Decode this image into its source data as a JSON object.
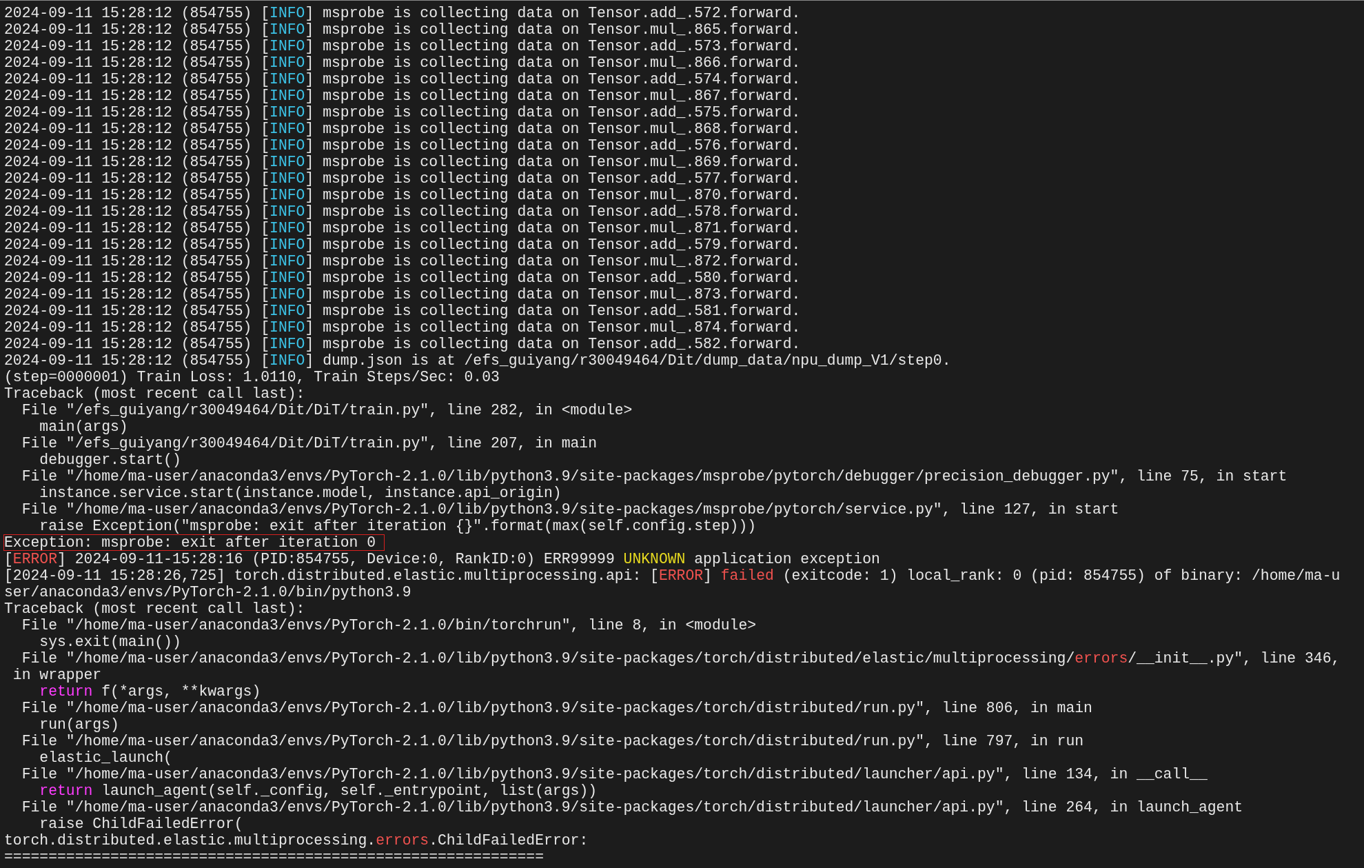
{
  "terminal": {
    "lines": [
      {
        "highlighted": false,
        "segments": [
          {
            "kind": "text",
            "text": "2024-09-11 15:28:12 (854755) ["
          },
          {
            "kind": "info",
            "text": "INFO"
          },
          {
            "kind": "text",
            "text": "] msprobe is collecting data on Tensor.add_.572.forward."
          }
        ]
      },
      {
        "highlighted": false,
        "segments": [
          {
            "kind": "text",
            "text": "2024-09-11 15:28:12 (854755) ["
          },
          {
            "kind": "info",
            "text": "INFO"
          },
          {
            "kind": "text",
            "text": "] msprobe is collecting data on Tensor.mul_.865.forward."
          }
        ]
      },
      {
        "highlighted": false,
        "segments": [
          {
            "kind": "text",
            "text": "2024-09-11 15:28:12 (854755) ["
          },
          {
            "kind": "info",
            "text": "INFO"
          },
          {
            "kind": "text",
            "text": "] msprobe is collecting data on Tensor.add_.573.forward."
          }
        ]
      },
      {
        "highlighted": false,
        "segments": [
          {
            "kind": "text",
            "text": "2024-09-11 15:28:12 (854755) ["
          },
          {
            "kind": "info",
            "text": "INFO"
          },
          {
            "kind": "text",
            "text": "] msprobe is collecting data on Tensor.mul_.866.forward."
          }
        ]
      },
      {
        "highlighted": false,
        "segments": [
          {
            "kind": "text",
            "text": "2024-09-11 15:28:12 (854755) ["
          },
          {
            "kind": "info",
            "text": "INFO"
          },
          {
            "kind": "text",
            "text": "] msprobe is collecting data on Tensor.add_.574.forward."
          }
        ]
      },
      {
        "highlighted": false,
        "segments": [
          {
            "kind": "text",
            "text": "2024-09-11 15:28:12 (854755) ["
          },
          {
            "kind": "info",
            "text": "INFO"
          },
          {
            "kind": "text",
            "text": "] msprobe is collecting data on Tensor.mul_.867.forward."
          }
        ]
      },
      {
        "highlighted": false,
        "segments": [
          {
            "kind": "text",
            "text": "2024-09-11 15:28:12 (854755) ["
          },
          {
            "kind": "info",
            "text": "INFO"
          },
          {
            "kind": "text",
            "text": "] msprobe is collecting data on Tensor.add_.575.forward."
          }
        ]
      },
      {
        "highlighted": false,
        "segments": [
          {
            "kind": "text",
            "text": "2024-09-11 15:28:12 (854755) ["
          },
          {
            "kind": "info",
            "text": "INFO"
          },
          {
            "kind": "text",
            "text": "] msprobe is collecting data on Tensor.mul_.868.forward."
          }
        ]
      },
      {
        "highlighted": false,
        "segments": [
          {
            "kind": "text",
            "text": "2024-09-11 15:28:12 (854755) ["
          },
          {
            "kind": "info",
            "text": "INFO"
          },
          {
            "kind": "text",
            "text": "] msprobe is collecting data on Tensor.add_.576.forward."
          }
        ]
      },
      {
        "highlighted": false,
        "segments": [
          {
            "kind": "text",
            "text": "2024-09-11 15:28:12 (854755) ["
          },
          {
            "kind": "info",
            "text": "INFO"
          },
          {
            "kind": "text",
            "text": "] msprobe is collecting data on Tensor.mul_.869.forward."
          }
        ]
      },
      {
        "highlighted": false,
        "segments": [
          {
            "kind": "text",
            "text": "2024-09-11 15:28:12 (854755) ["
          },
          {
            "kind": "info",
            "text": "INFO"
          },
          {
            "kind": "text",
            "text": "] msprobe is collecting data on Tensor.add_.577.forward."
          }
        ]
      },
      {
        "highlighted": false,
        "segments": [
          {
            "kind": "text",
            "text": "2024-09-11 15:28:12 (854755) ["
          },
          {
            "kind": "info",
            "text": "INFO"
          },
          {
            "kind": "text",
            "text": "] msprobe is collecting data on Tensor.mul_.870.forward."
          }
        ]
      },
      {
        "highlighted": false,
        "segments": [
          {
            "kind": "text",
            "text": "2024-09-11 15:28:12 (854755) ["
          },
          {
            "kind": "info",
            "text": "INFO"
          },
          {
            "kind": "text",
            "text": "] msprobe is collecting data on Tensor.add_.578.forward."
          }
        ]
      },
      {
        "highlighted": false,
        "segments": [
          {
            "kind": "text",
            "text": "2024-09-11 15:28:12 (854755) ["
          },
          {
            "kind": "info",
            "text": "INFO"
          },
          {
            "kind": "text",
            "text": "] msprobe is collecting data on Tensor.mul_.871.forward."
          }
        ]
      },
      {
        "highlighted": false,
        "segments": [
          {
            "kind": "text",
            "text": "2024-09-11 15:28:12 (854755) ["
          },
          {
            "kind": "info",
            "text": "INFO"
          },
          {
            "kind": "text",
            "text": "] msprobe is collecting data on Tensor.add_.579.forward."
          }
        ]
      },
      {
        "highlighted": false,
        "segments": [
          {
            "kind": "text",
            "text": "2024-09-11 15:28:12 (854755) ["
          },
          {
            "kind": "info",
            "text": "INFO"
          },
          {
            "kind": "text",
            "text": "] msprobe is collecting data on Tensor.mul_.872.forward."
          }
        ]
      },
      {
        "highlighted": false,
        "segments": [
          {
            "kind": "text",
            "text": "2024-09-11 15:28:12 (854755) ["
          },
          {
            "kind": "info",
            "text": "INFO"
          },
          {
            "kind": "text",
            "text": "] msprobe is collecting data on Tensor.add_.580.forward."
          }
        ]
      },
      {
        "highlighted": false,
        "segments": [
          {
            "kind": "text",
            "text": "2024-09-11 15:28:12 (854755) ["
          },
          {
            "kind": "info",
            "text": "INFO"
          },
          {
            "kind": "text",
            "text": "] msprobe is collecting data on Tensor.mul_.873.forward."
          }
        ]
      },
      {
        "highlighted": false,
        "segments": [
          {
            "kind": "text",
            "text": "2024-09-11 15:28:12 (854755) ["
          },
          {
            "kind": "info",
            "text": "INFO"
          },
          {
            "kind": "text",
            "text": "] msprobe is collecting data on Tensor.add_.581.forward."
          }
        ]
      },
      {
        "highlighted": false,
        "segments": [
          {
            "kind": "text",
            "text": "2024-09-11 15:28:12 (854755) ["
          },
          {
            "kind": "info",
            "text": "INFO"
          },
          {
            "kind": "text",
            "text": "] msprobe is collecting data on Tensor.mul_.874.forward."
          }
        ]
      },
      {
        "highlighted": false,
        "segments": [
          {
            "kind": "text",
            "text": "2024-09-11 15:28:12 (854755) ["
          },
          {
            "kind": "info",
            "text": "INFO"
          },
          {
            "kind": "text",
            "text": "] msprobe is collecting data on Tensor.add_.582.forward."
          }
        ]
      },
      {
        "highlighted": false,
        "segments": [
          {
            "kind": "text",
            "text": "2024-09-11 15:28:12 (854755) ["
          },
          {
            "kind": "info",
            "text": "INFO"
          },
          {
            "kind": "text",
            "text": "] dump.json is at /efs_guiyang/r30049464/Dit/dump_data/npu_dump_V1/step0."
          }
        ]
      },
      {
        "highlighted": false,
        "segments": [
          {
            "kind": "text",
            "text": "(step=0000001) Train Loss: 1.0110, Train Steps/Sec: 0.03"
          }
        ]
      },
      {
        "highlighted": false,
        "segments": [
          {
            "kind": "text",
            "text": "Traceback (most recent call last):"
          }
        ]
      },
      {
        "highlighted": false,
        "segments": [
          {
            "kind": "text",
            "text": "  File \"/efs_guiyang/r30049464/Dit/DiT/train.py\", line 282, in <module>"
          }
        ]
      },
      {
        "highlighted": false,
        "segments": [
          {
            "kind": "text",
            "text": "    main(args)"
          }
        ]
      },
      {
        "highlighted": false,
        "segments": [
          {
            "kind": "text",
            "text": "  File \"/efs_guiyang/r30049464/Dit/DiT/train.py\", line 207, in main"
          }
        ]
      },
      {
        "highlighted": false,
        "segments": [
          {
            "kind": "text",
            "text": "    debugger.start()"
          }
        ]
      },
      {
        "highlighted": false,
        "segments": [
          {
            "kind": "text",
            "text": "  File \"/home/ma-user/anaconda3/envs/PyTorch-2.1.0/lib/python3.9/site-packages/msprobe/pytorch/debugger/precision_debugger.py\", line 75, in start"
          }
        ]
      },
      {
        "highlighted": false,
        "segments": [
          {
            "kind": "text",
            "text": "    instance.service.start(instance.model, instance.api_origin)"
          }
        ]
      },
      {
        "highlighted": false,
        "segments": [
          {
            "kind": "text",
            "text": "  File \"/home/ma-user/anaconda3/envs/PyTorch-2.1.0/lib/python3.9/site-packages/msprobe/pytorch/service.py\", line 127, in start"
          }
        ]
      },
      {
        "highlighted": false,
        "segments": [
          {
            "kind": "text",
            "text": "    raise Exception(\"msprobe: exit after iteration {}\".format(max(self.config.step)))"
          }
        ]
      },
      {
        "highlighted": true,
        "segments": [
          {
            "kind": "text",
            "text": "Exception: msprobe: exit after iteration 0"
          }
        ]
      },
      {
        "highlighted": false,
        "segments": [
          {
            "kind": "text",
            "text": "["
          },
          {
            "kind": "error",
            "text": "ERROR"
          },
          {
            "kind": "text",
            "text": "] 2024-09-11-15:28:16 (PID:854755, Device:0, RankID:0) ERR99999 "
          },
          {
            "kind": "warning",
            "text": "UNKNOWN"
          },
          {
            "kind": "text",
            "text": " application exception"
          }
        ]
      },
      {
        "highlighted": false,
        "segments": [
          {
            "kind": "text",
            "text": "[2024-09-11 15:28:26,725] torch.distributed.elastic.multiprocessing.api: ["
          },
          {
            "kind": "error",
            "text": "ERROR"
          },
          {
            "kind": "text",
            "text": "] "
          },
          {
            "kind": "error",
            "text": "failed"
          },
          {
            "kind": "text",
            "text": " (exitcode: 1) local_rank: 0 (pid: 854755) of binary: /home/ma-u"
          }
        ]
      },
      {
        "highlighted": false,
        "segments": [
          {
            "kind": "text",
            "text": "ser/anaconda3/envs/PyTorch-2.1.0/bin/python3.9"
          }
        ]
      },
      {
        "highlighted": false,
        "segments": [
          {
            "kind": "text",
            "text": "Traceback (most recent call last):"
          }
        ]
      },
      {
        "highlighted": false,
        "segments": [
          {
            "kind": "text",
            "text": "  File \"/home/ma-user/anaconda3/envs/PyTorch-2.1.0/bin/torchrun\", line 8, in <module>"
          }
        ]
      },
      {
        "highlighted": false,
        "segments": [
          {
            "kind": "text",
            "text": "    sys.exit(main())"
          }
        ]
      },
      {
        "highlighted": false,
        "segments": [
          {
            "kind": "text",
            "text": "  File \"/home/ma-user/anaconda3/envs/PyTorch-2.1.0/lib/python3.9/site-packages/torch/distributed/elastic/multiprocessing/"
          },
          {
            "kind": "error",
            "text": "errors"
          },
          {
            "kind": "text",
            "text": "/__init__.py\", line 346,"
          }
        ]
      },
      {
        "highlighted": false,
        "segments": [
          {
            "kind": "text",
            "text": " in wrapper"
          }
        ]
      },
      {
        "highlighted": false,
        "segments": [
          {
            "kind": "keyword",
            "text": "    return"
          },
          {
            "kind": "text",
            "text": " f(*args, **kwargs)"
          }
        ]
      },
      {
        "highlighted": false,
        "segments": [
          {
            "kind": "text",
            "text": "  File \"/home/ma-user/anaconda3/envs/PyTorch-2.1.0/lib/python3.9/site-packages/torch/distributed/run.py\", line 806, in main"
          }
        ]
      },
      {
        "highlighted": false,
        "segments": [
          {
            "kind": "text",
            "text": "    run(args)"
          }
        ]
      },
      {
        "highlighted": false,
        "segments": [
          {
            "kind": "text",
            "text": "  File \"/home/ma-user/anaconda3/envs/PyTorch-2.1.0/lib/python3.9/site-packages/torch/distributed/run.py\", line 797, in run"
          }
        ]
      },
      {
        "highlighted": false,
        "segments": [
          {
            "kind": "text",
            "text": "    elastic_launch("
          }
        ]
      },
      {
        "highlighted": false,
        "segments": [
          {
            "kind": "text",
            "text": "  File \"/home/ma-user/anaconda3/envs/PyTorch-2.1.0/lib/python3.9/site-packages/torch/distributed/launcher/api.py\", line 134, in __call__"
          }
        ]
      },
      {
        "highlighted": false,
        "segments": [
          {
            "kind": "keyword",
            "text": "    return"
          },
          {
            "kind": "text",
            "text": " launch_agent(self._config, self._entrypoint, list(args))"
          }
        ]
      },
      {
        "highlighted": false,
        "segments": [
          {
            "kind": "text",
            "text": "  File \"/home/ma-user/anaconda3/envs/PyTorch-2.1.0/lib/python3.9/site-packages/torch/distributed/launcher/api.py\", line 264, in launch_agent"
          }
        ]
      },
      {
        "highlighted": false,
        "segments": [
          {
            "kind": "text",
            "text": "    raise ChildFailedError("
          }
        ]
      },
      {
        "highlighted": false,
        "segments": [
          {
            "kind": "text",
            "text": "torch.distributed.elastic.multiprocessing."
          },
          {
            "kind": "error",
            "text": "errors"
          },
          {
            "kind": "text",
            "text": ".ChildFailedError:"
          }
        ]
      },
      {
        "highlighted": false,
        "segments": [
          {
            "kind": "text",
            "text": "============================================================="
          }
        ]
      }
    ]
  }
}
